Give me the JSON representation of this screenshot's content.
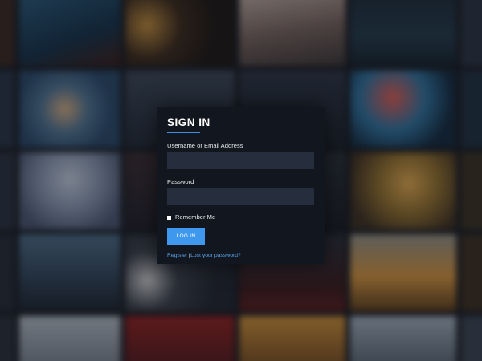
{
  "login": {
    "title": "SIGN IN",
    "username_label": "Username or Email Address",
    "username_value": "",
    "password_label": "Password",
    "password_value": "",
    "remember_label": "Remember Me",
    "remember_checked": false,
    "login_button": "LOG IN",
    "register_link": "Register",
    "separator": "|",
    "lost_password_link": "Lost your password?"
  },
  "colors": {
    "accent": "#3e99ee",
    "card_background": "#12161f",
    "input_background": "#262d3d",
    "link": "#5aa6ef"
  }
}
